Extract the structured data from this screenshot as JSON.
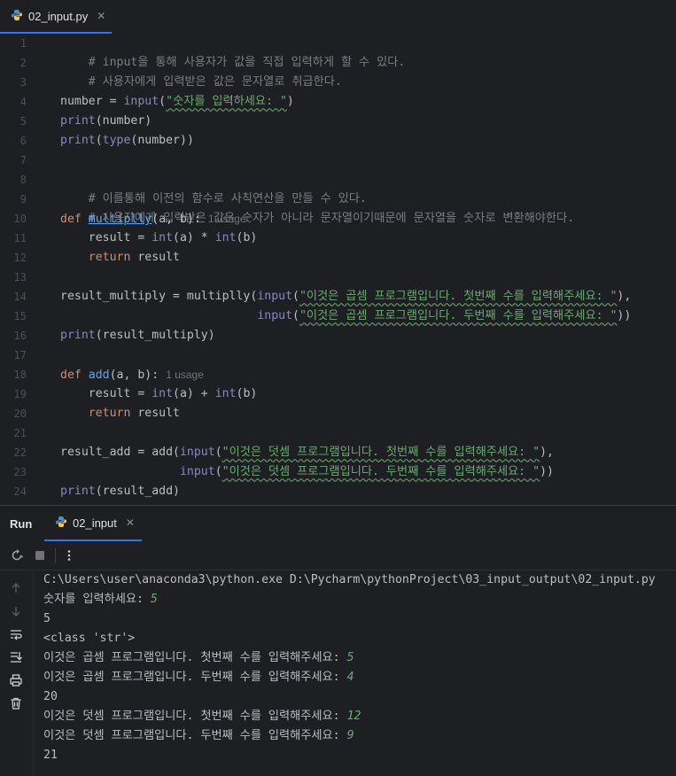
{
  "editor_tab": {
    "filename": "02_input.py",
    "close": "✕"
  },
  "editor": {
    "line_numbers": [
      "1",
      "2",
      "3",
      "4",
      "5",
      "6",
      "7",
      "8",
      "9",
      "10",
      "11",
      "12",
      "13",
      "14",
      "15",
      "16",
      "17",
      "18",
      "19",
      "20",
      "21",
      "22",
      "23",
      "24"
    ],
    "lines": {
      "l1": "# input을 통해 사용자가 값을 직접 입력하게 할 수 있다.",
      "l2": "# 사용자에게 입력받은 값은 문자열로 취급한다.",
      "l4_var": "number = ",
      "l4_fn": "input",
      "l4_open": "(",
      "l4_str": "\"숫자를 입력하세요: \"",
      "l4_close": ")",
      "l5_fn": "print",
      "l5_rest": "(number)",
      "l6_fn": "print",
      "l6_open": "(",
      "l6_fn2": "type",
      "l6_rest": "(number))",
      "l8": "# 이를통해 이전의 함수로 사칙연산을 만들 수 있다.",
      "l9": "# 사용자에게 입력받은 값은 숫자가 아니라 문자열이기때문에 문자열을 숫자로 변환해야한다.",
      "l10_kw": "def",
      "l10_name": "multiplly",
      "l10_rest": "(a, b):",
      "l10_hint": "1 usage",
      "l11_a": "    result = ",
      "l11_int1": "int",
      "l11_b": "(a) * ",
      "l11_int2": "int",
      "l11_c": "(b)",
      "l12_kw": "    return",
      "l12_rest": " result",
      "l14_a": "result_multiply = multiplly(",
      "l14_fn": "input",
      "l14_open": "(",
      "l14_str": "\"이것은 곱셈 프로그램입니다. 첫번째 수를 입력해주세요: \"",
      "l14_close": "),",
      "l15_pad": "                            ",
      "l15_fn": "input",
      "l15_open": "(",
      "l15_str": "\"이것은 곱셈 프로그램입니다. 두번째 수를 입력해주세요: \"",
      "l15_close": "))",
      "l16_fn": "print",
      "l16_rest": "(result_multiply)",
      "l18_kw": "def",
      "l18_name": "add",
      "l18_rest": "(a, b):",
      "l18_hint": "1 usage",
      "l19_a": "    result = ",
      "l19_int1": "int",
      "l19_b": "(a) + ",
      "l19_int2": "int",
      "l19_c": "(b)",
      "l20_kw": "    return",
      "l20_rest": " result",
      "l22_a": "result_add = add(",
      "l22_fn": "input",
      "l22_open": "(",
      "l22_str": "\"이것은 덧셈 프로그램입니다. 첫번째 수를 입력해주세요: \"",
      "l22_close": "),",
      "l23_pad": "                 ",
      "l23_fn": "input",
      "l23_open": "(",
      "l23_str": "\"이것은 덧셈 프로그램입니다. 두번째 수를 입력해주세요: \"",
      "l23_close": "))",
      "l24_fn": "print",
      "l24_rest": "(result_add)"
    }
  },
  "run_panel": {
    "title": "Run",
    "tab_label": "02_input",
    "close": "✕",
    "console": [
      {
        "text": "C:\\Users\\user\\anaconda3\\python.exe D:\\Pycharm\\pythonProject\\03_input_output\\02_input.py",
        "input": ""
      },
      {
        "text": "숫자를 입력하세요: ",
        "input": "5"
      },
      {
        "text": "5",
        "input": ""
      },
      {
        "text": "<class 'str'>",
        "input": ""
      },
      {
        "text": "이것은 곱셈 프로그램입니다. 첫번째 수를 입력해주세요: ",
        "input": "5"
      },
      {
        "text": "이것은 곱셈 프로그램입니다. 두번째 수를 입력해주세요: ",
        "input": "4"
      },
      {
        "text": "20",
        "input": ""
      },
      {
        "text": "이것은 덧셈 프로그램입니다. 첫번째 수를 입력해주세요: ",
        "input": "12"
      },
      {
        "text": "이것은 덧셈 프로그램입니다. 두번째 수를 입력해주세요: ",
        "input": "9"
      },
      {
        "text": "21",
        "input": ""
      }
    ]
  },
  "icons": {
    "python": "python-file-icon",
    "rerun": "rerun-icon",
    "stop": "stop-icon",
    "more": "more-options-icon",
    "up": "arrow-up-icon",
    "down": "arrow-down-icon",
    "wrap": "soft-wrap-icon",
    "scroll_end": "scroll-to-end-icon",
    "print": "print-icon",
    "trash": "trash-icon"
  },
  "colors": {
    "background": "#1e1f22",
    "keyword": "#cf8e6d",
    "builtin": "#8888c6",
    "string": "#6aab73",
    "function": "#56a8f5",
    "comment": "#7a7e85",
    "accent": "#3574f0"
  }
}
